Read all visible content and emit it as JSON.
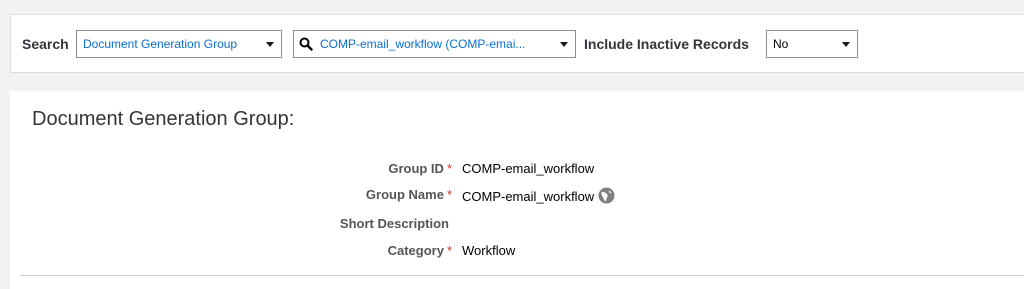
{
  "search": {
    "label": "Search",
    "object_type": {
      "selected": "Document Generation Group"
    },
    "record": {
      "selected": "COMP-email_workflow (COMP-emai..."
    },
    "include_inactive": {
      "label": "Include Inactive Records",
      "selected": "No"
    }
  },
  "panel": {
    "title": "Document Generation Group:",
    "fields": [
      {
        "label": "Group ID",
        "required": "*",
        "value": "COMP-email_workflow"
      },
      {
        "label": "Group Name",
        "required": "*",
        "value": "COMP-email_workflow"
      },
      {
        "label": "Short Description",
        "required": "",
        "value": ""
      },
      {
        "label": "Category",
        "required": "*",
        "value": "Workflow"
      }
    ]
  },
  "colors": {
    "accent": "#0a6ed1",
    "required": "#e13434",
    "icon": "#7f7f7f"
  },
  "icons": {
    "record_search": "magnifier-icon",
    "translations": "globe-icon"
  }
}
